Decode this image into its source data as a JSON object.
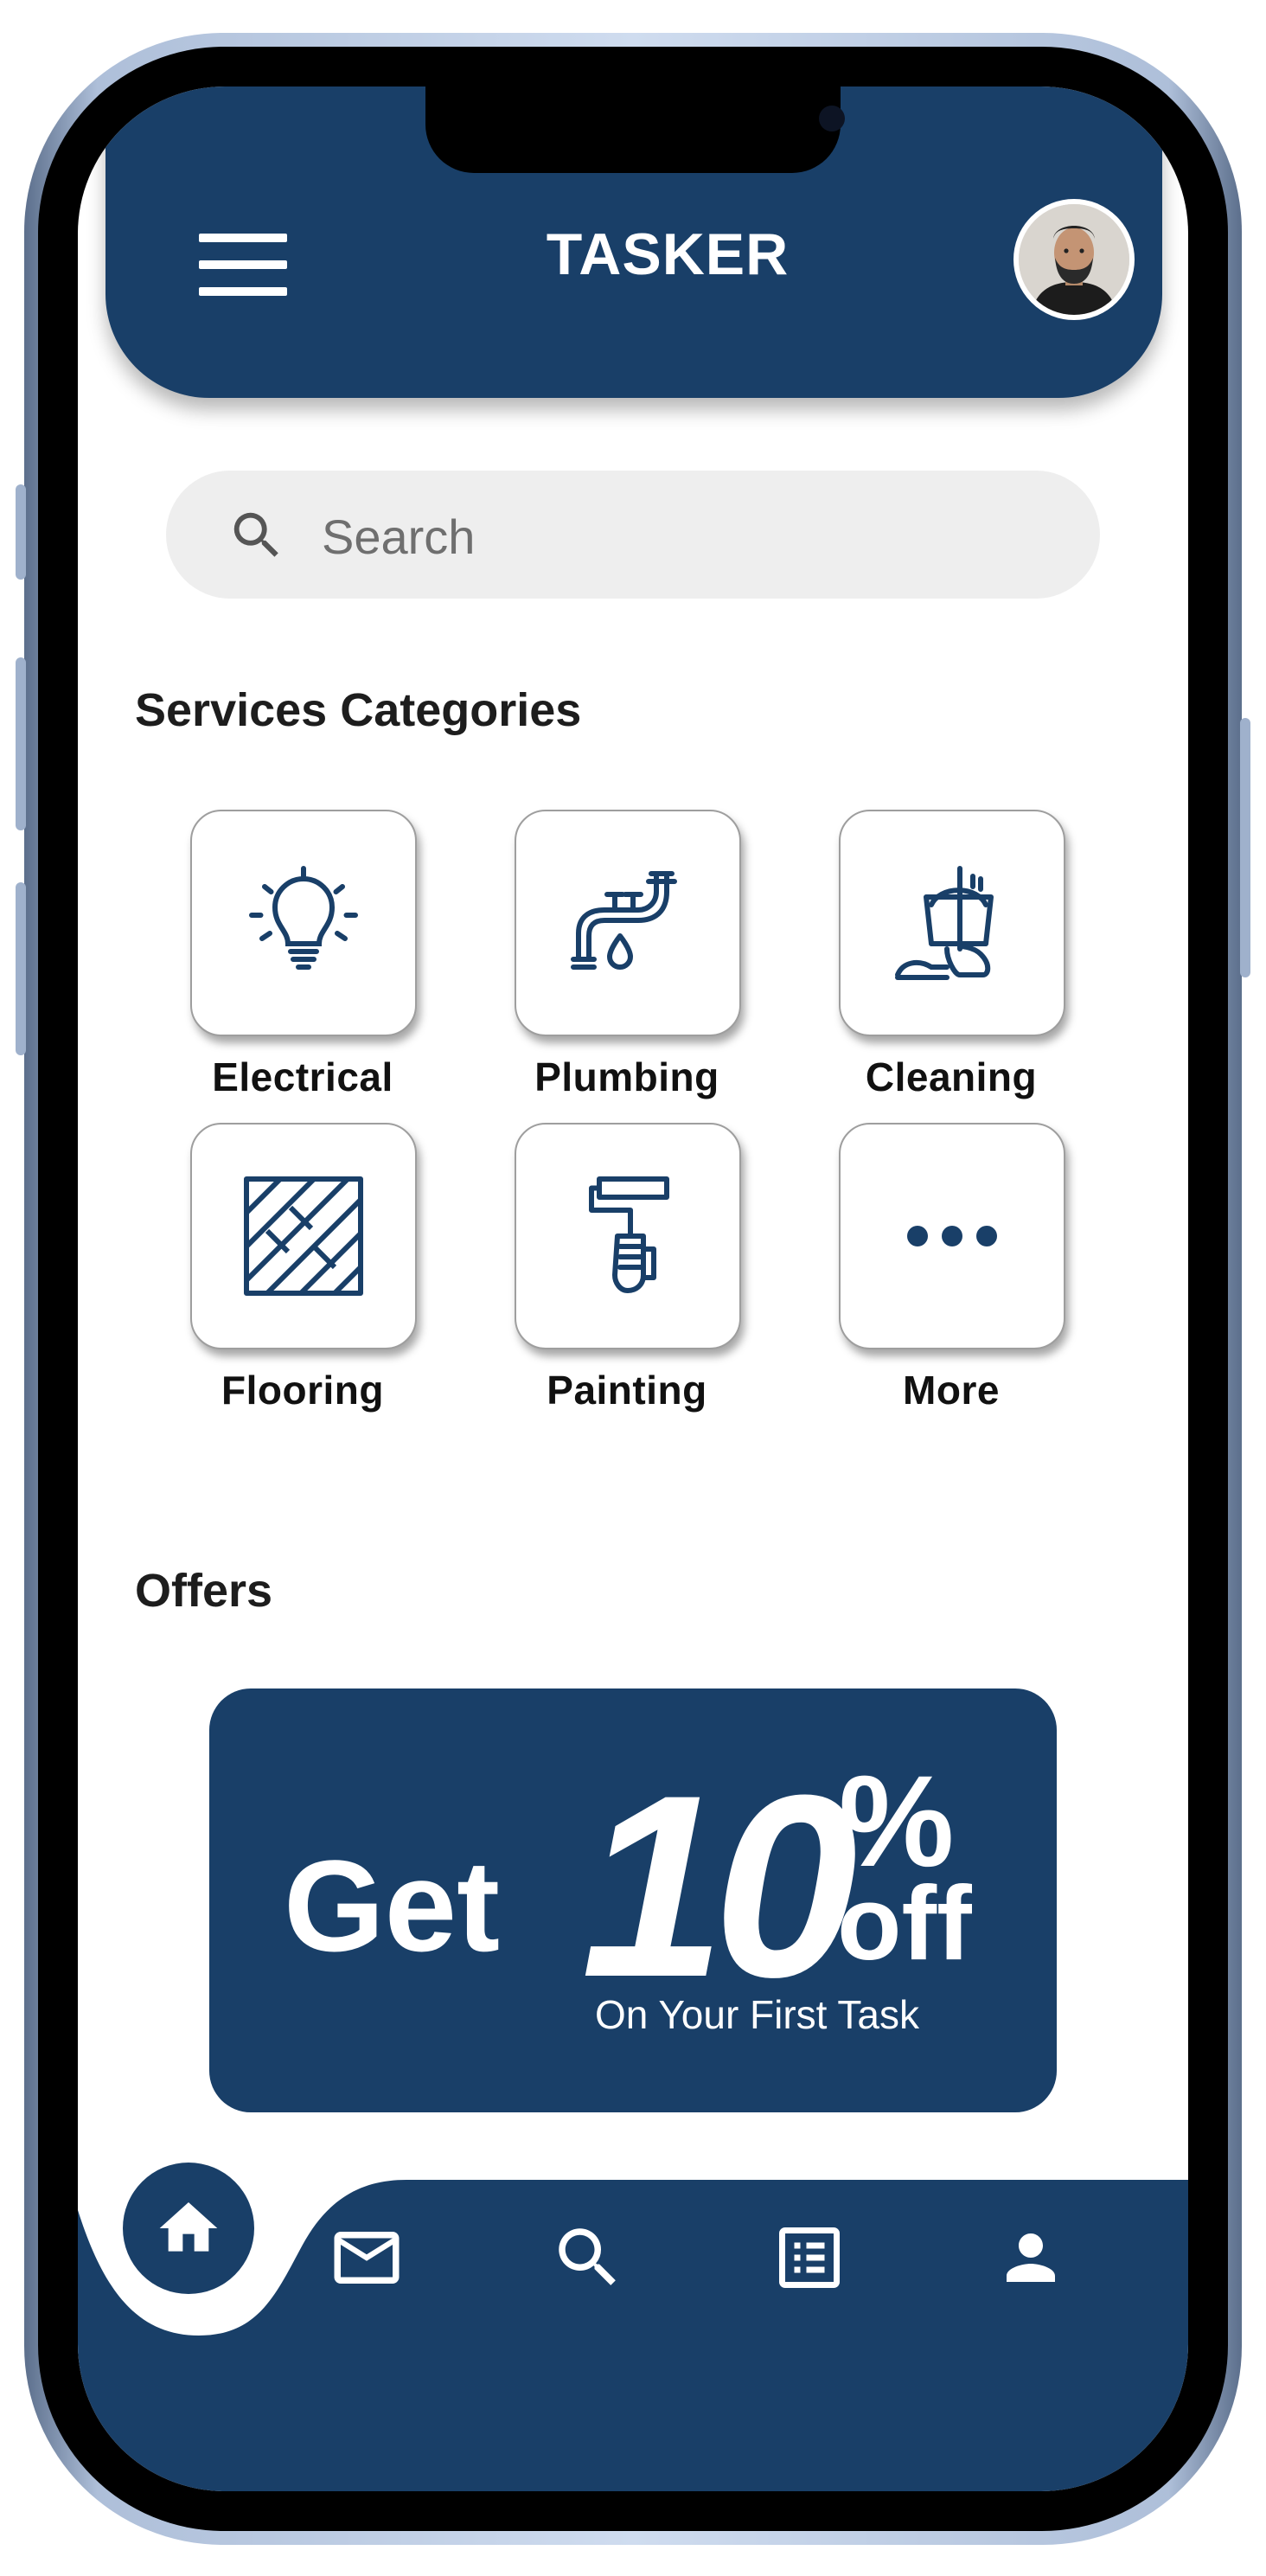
{
  "header": {
    "title": "TASKER"
  },
  "search": {
    "placeholder": "Search"
  },
  "services": {
    "title": "Services Categories",
    "items": [
      {
        "label": "Electrical",
        "icon": "lightbulb-icon"
      },
      {
        "label": "Plumbing",
        "icon": "faucet-icon"
      },
      {
        "label": "Cleaning",
        "icon": "mop-bucket-icon"
      },
      {
        "label": "Flooring",
        "icon": "floor-tiles-icon"
      },
      {
        "label": "Painting",
        "icon": "paint-roller-icon"
      },
      {
        "label": "More",
        "icon": "more-dots-icon"
      }
    ]
  },
  "offers": {
    "title": "Offers",
    "banner": {
      "get": "Get",
      "amount": "10",
      "percent": "%",
      "off": "off",
      "subtitle": "On Your First Task"
    }
  },
  "nav": {
    "items": [
      "home-icon",
      "mail-icon",
      "search-icon",
      "list-icon",
      "profile-icon"
    ]
  },
  "colors": {
    "primary": "#193f68",
    "search_bg": "#eeeeee",
    "background": "#ffffff"
  }
}
